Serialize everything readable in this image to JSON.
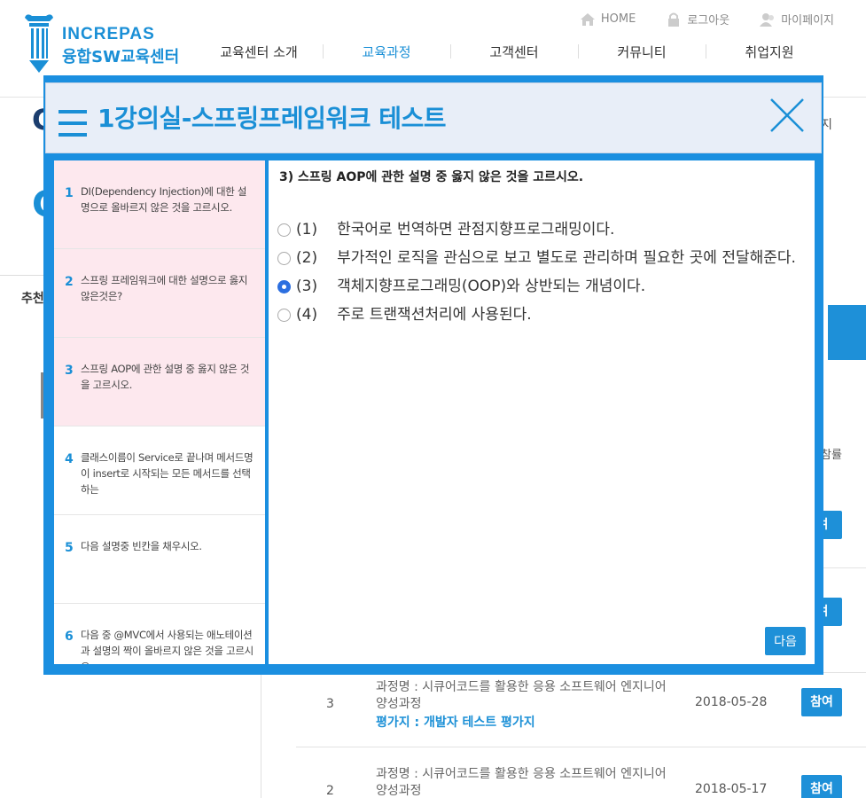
{
  "brand": {
    "en": "INCREPAS",
    "ko": "융합SW교육센터",
    "mark_text": "INCREPAS"
  },
  "util_nav": [
    {
      "label": "HOME"
    },
    {
      "label": "로그아웃"
    },
    {
      "label": "마이페이지"
    }
  ],
  "gnb": [
    {
      "label": "교육센터 소개"
    },
    {
      "label": "교육과정"
    },
    {
      "label": "고객센터"
    },
    {
      "label": "커뮤니티"
    },
    {
      "label": "취업지원"
    }
  ],
  "background": {
    "left_letter_1": "C",
    "left_letter_2": "C",
    "left_label": "추천",
    "right_text": "지",
    "rate_label": "참률",
    "partial_join": [
      "여",
      "여"
    ],
    "rows": [
      {
        "num": "3",
        "course": "과정명 : 시큐어코드를 활용한 응용 소프트웨어 엔지니어 양성과정",
        "eval": "평가지 : 개발자 테스트 평가지",
        "date": "2018-05-28",
        "action": "참여"
      },
      {
        "num": "2",
        "course": "과정명 : 시큐어코드를 활용한 응용 소프트웨어 엔지니어 양성과정",
        "eval": "",
        "date": "2018-05-17",
        "action": "참여"
      }
    ]
  },
  "modal": {
    "title": "1강의실-스프링프레임워크 테스트",
    "questions": [
      {
        "num": "1",
        "text": "DI(Dependency Injection)에 대한 설명으로 올바르지 않은 것을 고르시오."
      },
      {
        "num": "2",
        "text": "스프링 프레임워크에 대한 설명으로 옳지 않은것은?"
      },
      {
        "num": "3",
        "text": "스프링 AOP에 관한 설명 중 옳지 않은 것을 고르시오."
      },
      {
        "num": "4",
        "text": "클래스이름이 Service로 끝나며 메서드명이 insert로 시작되는 모든 메서드를 선택하는"
      },
      {
        "num": "5",
        "text": "다음 설명중 빈칸을 채우시오."
      },
      {
        "num": "6",
        "text": "다음 중 @MVC에서 사용되는 애노테이션과 설명의 짝이 올바르지 않은 것을 고르시오."
      }
    ],
    "answered": [
      true,
      true,
      true,
      false,
      false,
      false
    ],
    "current_question": "3) 스프링 AOP에 관한 설명 중 옳지 않은 것을 고르시오.",
    "options": [
      {
        "num": "(1)",
        "text": "한국어로 번역하면 관점지향프로그래밍이다.",
        "checked": false
      },
      {
        "num": "(2)",
        "text": "부가적인 로직을 관심으로 보고 별도로 관리하며 필요한 곳에 전달해준다.",
        "checked": false
      },
      {
        "num": "(3)",
        "text": "객체지향프로그래밍(OOP)와 상반되는 개념이다.",
        "checked": true
      },
      {
        "num": "(4)",
        "text": "주로 트랜잭션처리에 사용된다.",
        "checked": false
      }
    ],
    "next_label": "다음"
  },
  "colors": {
    "accent": "#1a8fd6",
    "modal_frame": "#1b8fe0",
    "answered_bg": "#fde8ee"
  }
}
